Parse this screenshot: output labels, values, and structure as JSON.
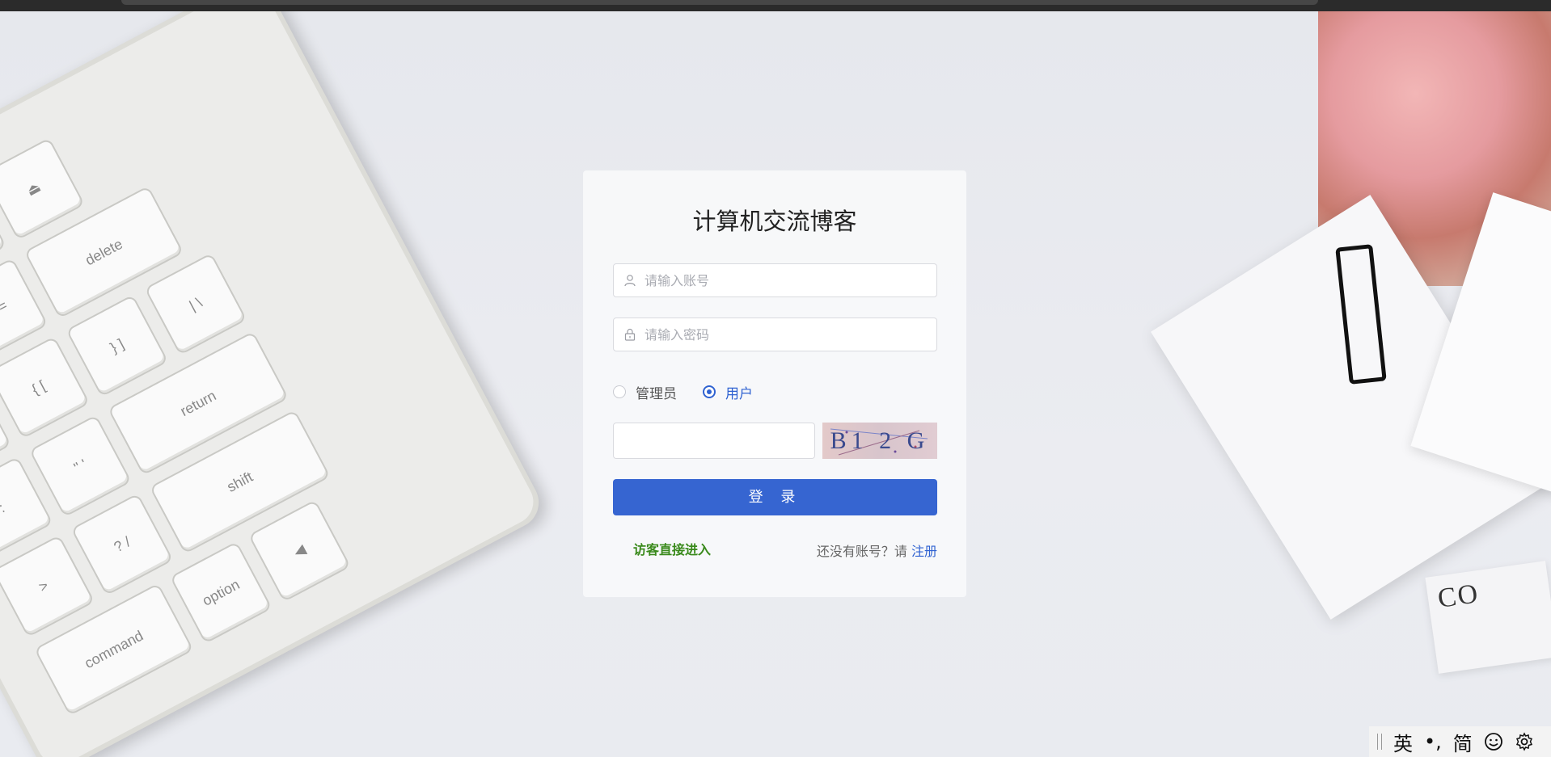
{
  "login": {
    "title": "计算机交流博客",
    "username_placeholder": "请输入账号",
    "password_placeholder": "请输入密码",
    "roles": [
      {
        "label": "管理员",
        "selected": false
      },
      {
        "label": "用户",
        "selected": true
      }
    ],
    "captcha_input_value": "",
    "captcha_text": "B1 2 G",
    "login_button": "登 录",
    "guest_link": "访客直接进入",
    "register_prompt": "还没有账号？请",
    "register_link": "注册"
  },
  "ime_bar": {
    "mode": "英",
    "punct": "•,",
    "charset": "简",
    "emoji_icon": "smiley-icon",
    "settings_icon": "gear-icon"
  },
  "background": {
    "card_text": "CO"
  }
}
